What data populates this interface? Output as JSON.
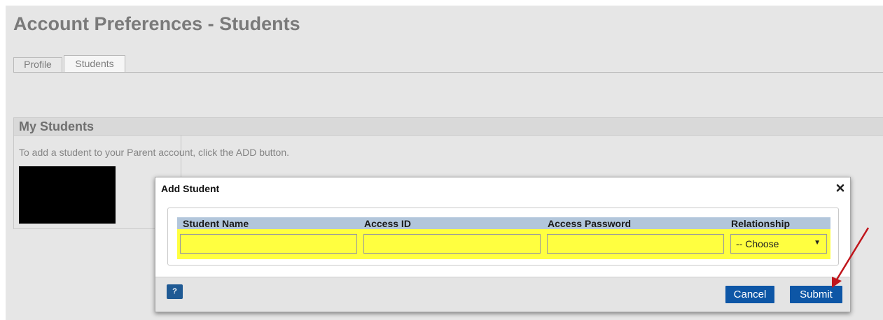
{
  "page": {
    "title": "Account Preferences - Students"
  },
  "tabs": [
    {
      "label": "Profile",
      "active": false
    },
    {
      "label": "Students",
      "active": true
    }
  ],
  "section": {
    "title": "My Students",
    "instructions": "To add a student to your Parent account, click the ADD button."
  },
  "modal": {
    "title": "Add Student",
    "close_icon": "close-icon",
    "columns": [
      "Student Name",
      "Access ID",
      "Access Password",
      "Relationship"
    ],
    "inputs": {
      "student_name": "",
      "access_id": "",
      "access_password": ""
    },
    "relationship_selected": "-- Choose",
    "help_label": "?",
    "cancel_label": "Cancel",
    "submit_label": "Submit"
  },
  "colors": {
    "highlight": "#ffff40",
    "header_row": "#b2c6db",
    "button": "#0d56a6",
    "arrow": "#c0151b"
  }
}
